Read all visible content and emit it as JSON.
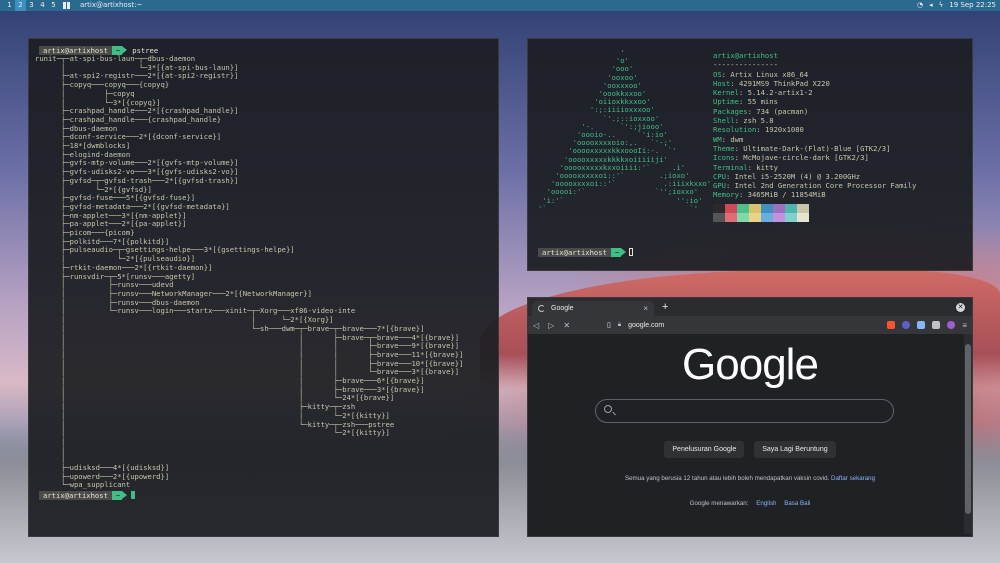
{
  "topbar": {
    "workspaces": [
      "1",
      "2",
      "3",
      "4",
      "5"
    ],
    "active_workspace": "2",
    "title": "artix@artixhost:~",
    "datetime": "19 Sep 22:25"
  },
  "terminal_left": {
    "user": "artix@artixhost",
    "dir": "~",
    "command": "pstree",
    "tree": "runit─┬─at-spi-bus-laun─┬─dbus-daemon\n      │                 └─3*[{at-spi-bus-laun}]\n      ├─at-spi2-registr───2*[{at-spi2-registr}]\n      ├─copyq───copyq───{copyq}\n      │         ├─copyq\n      │         └─3*[{copyq}]\n      ├─crashpad_handle───2*[{crashpad_handle}]\n      ├─crashpad_handle───{crashpad_handle}\n      ├─dbus-daemon\n      ├─dconf-service───2*[{dconf-service}]\n      ├─18*[dwmblocks]\n      ├─elogind-daemon\n      ├─gvfs-mtp-volume───2*[{gvfs-mtp-volume}]\n      ├─gvfs-udisks2-vo───3*[{gvfs-udisks2-vo}]\n      ├─gvfsd─┬─gvfsd-trash───2*[{gvfsd-trash}]\n      │       └─2*[{gvfsd}]\n      ├─gvfsd-fuse───5*[{gvfsd-fuse}]\n      ├─gvfsd-metadata───2*[{gvfsd-metadata}]\n      ├─nm-applet───3*[{nm-applet}]\n      ├─pa-applet───2*[{pa-applet}]\n      ├─picom───{picom}\n      ├─polkitd───7*[{polkitd}]\n      ├─pulseaudio─┬─gsettings-helpe───3*[{gsettings-helpe}]\n      │            └─2*[{pulseaudio}]\n      ├─rtkit-daemon───2*[{rtkit-daemon}]\n      ├─runsvdir─┬─5*[runsv───agetty]\n      │          ├─runsv───udevd\n      │          ├─runsv───NetworkManager───2*[{NetworkManager}]\n      │          ├─runsv───dbus-daemon\n      │          └─runsv───login───startx───xinit─┬─Xorg───xf86-video-inte\n      │                                           │      └─2*[{Xorg}]\n      │                                           └─sh───dwm─┬─brave─┬─brave───7*[{brave}]\n      │                                                      │       ├─brave─┬─brave───4*[{brave}]\n      │                                                      │       │       ├─brave───9*[{brave}]\n      │                                                      │       │       ├─brave───11*[{brave}]\n      │                                                      │       │       ├─brave───10*[{brave}]\n      │                                                      │       │       └─brave───3*[{brave}]\n      │                                                      │       ├─brave───6*[{brave}]\n      │                                                      │       ├─brave───3*[{brave}]\n      │                                                      │       └─24*[{brave}]\n      │                                                      ├─kitty─┬─zsh\n      │                                                      │       └─2*[{kitty}]\n      │                                                      └─kitty─┬─zsh───pstree\n      │                                                              └─2*[{kitty}]\n      │\n      │\n      │\n      ├─udisksd───4*[{udisksd}]\n      ├─upowerd───2*[{upowerd}]\n      └─wpa_supplicant"
  },
  "terminal_right": {
    "logo": "                   '\n                  'o'\n                 'ooo'\n                'ooxoo'\n               'ooxxxoo'\n              'oookkxxoo'\n             'oiioxkkxxoo'\n            ':;:iiiioxxxoo'\n               `'.;::ioxxoo'\n          '-.      `':;jiooo'\n         'oooio-..     `'i:io'\n        'ooooxxxxoio:,.   `'-;'\n       'ooooxxxxxkkxoooIi:-.  `'\n      'ooooxxxxxkkkkxoiiiiiji'\n     'ooooxxxxxkxxoiiii:'`     .i'\n    'ooooxxxxxoi::'`        .;ioxo'\n   'ooooxxxxoi::'`           .:iiixkxxo'\n  'ooooi:'`                `'';ioxxo'\n 'i:'`                          '':io'\n'`                                 `'",
    "header": "artix@artixhost",
    "separator": "---------------",
    "rows": [
      {
        "k": "OS",
        "v": "Artix Linux x86_64"
      },
      {
        "k": "Host",
        "v": "4291MS9 ThinkPad X220"
      },
      {
        "k": "Kernel",
        "v": "5.14.2-artix1-2"
      },
      {
        "k": "Uptime",
        "v": "55 mins"
      },
      {
        "k": "Packages",
        "v": "734 (pacman)"
      },
      {
        "k": "Shell",
        "v": "zsh 5.8"
      },
      {
        "k": "Resolution",
        "v": "1920x1080"
      },
      {
        "k": "WM",
        "v": "dwm"
      },
      {
        "k": "Theme",
        "v": "Ultimate-Dark-(Flat)-Blue [GTK2/3]"
      },
      {
        "k": "Icons",
        "v": "McMojave-circle-dark [GTK2/3]"
      },
      {
        "k": "Terminal",
        "v": "kitty"
      },
      {
        "k": "CPU",
        "v": "Intel i5-2520M (4) @ 3.200GHz"
      },
      {
        "k": "GPU",
        "v": "Intel 2nd Generation Core Processor Family"
      },
      {
        "k": "Memory",
        "v": "3465MiB / 11854MiB"
      }
    ],
    "swatches_top": [
      "#2a2a2a",
      "#d0495b",
      "#4fbf8a",
      "#d9c26a",
      "#3f8fc0",
      "#9d6fbf",
      "#4fb3b0",
      "#c9c6a9"
    ],
    "swatches_bottom": [
      "#555555",
      "#e06c75",
      "#7fd9a8",
      "#e8d489",
      "#6aaee0",
      "#c291e0",
      "#7fd1ce",
      "#e6e3cf"
    ],
    "user": "artix@artixhost",
    "dir": "~"
  },
  "browser": {
    "tab_title": "Google",
    "tab_close": "×",
    "new_tab": "+",
    "url": "google.com",
    "logo": "Google",
    "btn_search": "Penelusuran Google",
    "btn_lucky": "Saya Lagi Beruntung",
    "notice": "Semua yang berusia 12 tahun atau lebih boleh mendapatkan vaksin covid.",
    "notice_link": "Daftar sekarang",
    "offered_in": "Google menawarkan:",
    "lang_1": "English",
    "lang_2": "Basa Bali"
  }
}
